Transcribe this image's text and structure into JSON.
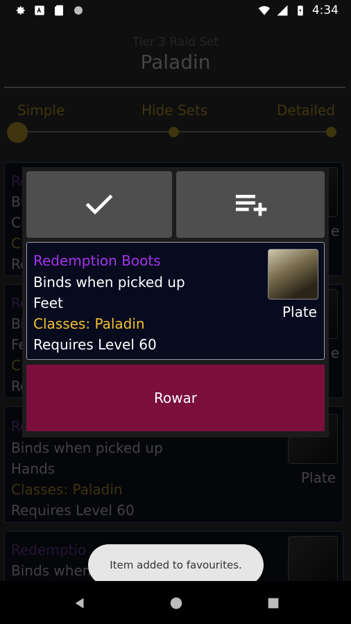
{
  "status_bar": {
    "time": "4:34"
  },
  "header": {
    "subtitle": "Tier 3 Raid Set",
    "title": "Paladin"
  },
  "filter": {
    "options": [
      "Simple",
      "Hide Sets",
      "Detailed"
    ],
    "selected": "Simple"
  },
  "list": {
    "cards": [
      {
        "name": "Re",
        "line1": "Bi",
        "line2": "Cl",
        "line3": "Cl",
        "line4": "Re",
        "slot_label": "e"
      },
      {
        "name": "Re",
        "line1": "Bi",
        "line2": "Fe",
        "line3": "Cl",
        "line4": "Re",
        "slot_label": "e"
      },
      {
        "name": "Re",
        "binds": "Binds when picked up",
        "slot": "Hands",
        "classes": "Classes: Paladin",
        "level": "Requires Level 60",
        "armor": "Plate"
      },
      {
        "name": "Redemptio",
        "binds": "Binds when picked up"
      }
    ]
  },
  "dialog": {
    "confirm_icon": "check-icon",
    "add_to_list_icon": "playlist-add-icon",
    "item": {
      "name": "Redemption Boots",
      "binds": "Binds when picked up",
      "slot": "Feet",
      "classes": "Classes: Paladin",
      "level": "Requires Level 60",
      "armor": "Plate"
    },
    "action_button": "Rowar"
  },
  "toast": {
    "message": "Item added to favourites."
  },
  "colors": {
    "epic_purple": "#a335ee",
    "class_gold": "#f2c12e",
    "accent_gold": "#7d6a1c",
    "action_red": "#7a0f3c"
  }
}
